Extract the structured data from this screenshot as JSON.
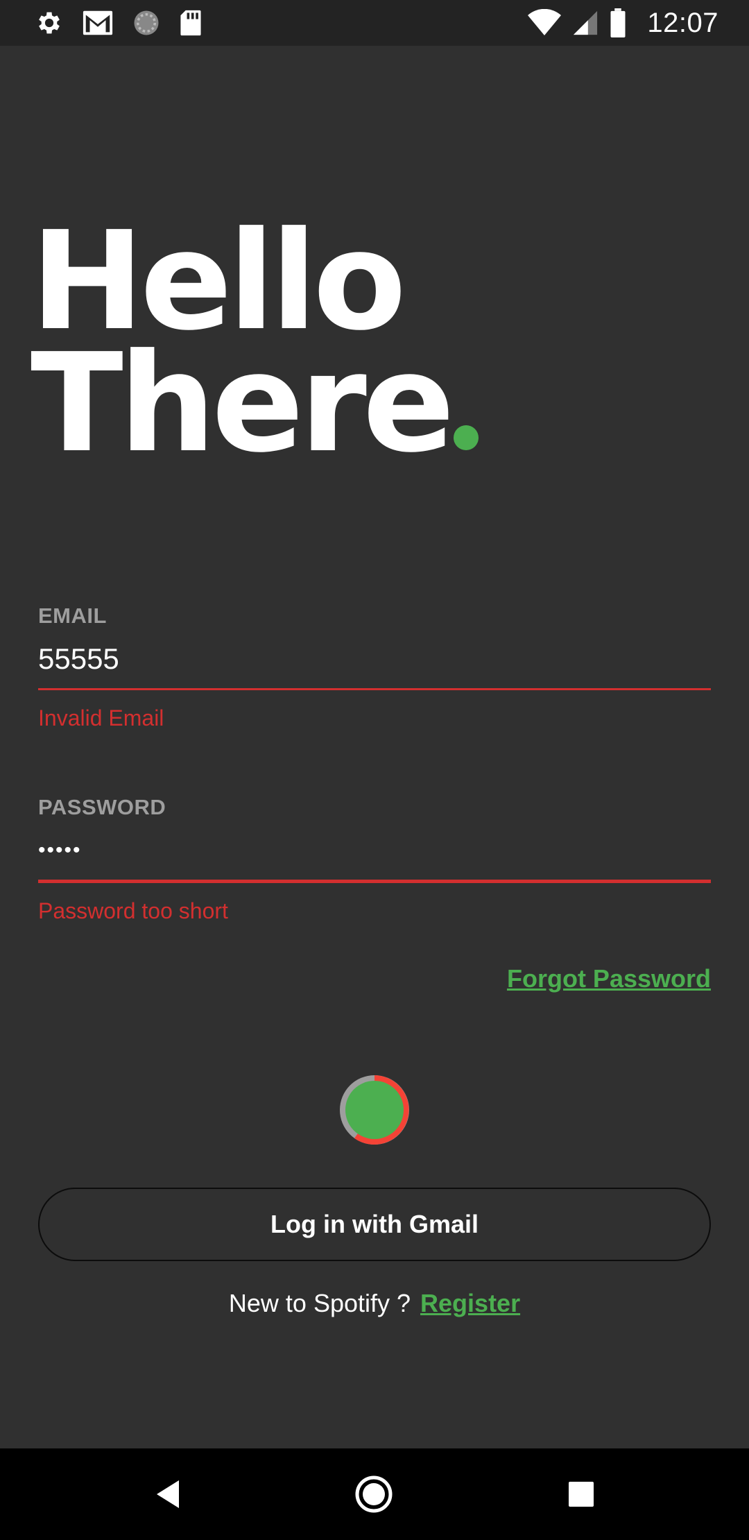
{
  "status_bar": {
    "time": "12:07",
    "left_icons": [
      "gear-icon",
      "gmail-icon",
      "sync-icon",
      "sd-card-icon"
    ],
    "right_icons": [
      "wifi-icon",
      "cell-signal-icon",
      "battery-icon"
    ]
  },
  "heading": {
    "line1": "Hello",
    "line2": "There",
    "accent_color": "#4caf50"
  },
  "email_field": {
    "label": "EMAIL",
    "value": "55555",
    "error": "Invalid Email"
  },
  "password_field": {
    "label": "PASSWORD",
    "value": "•••••",
    "error": "Password too short"
  },
  "forgot_password": "Forgot Password",
  "gmail_button": "Log in with Gmail",
  "register": {
    "prompt": "New to Spotify ?",
    "link": "Register"
  },
  "nav_bar": {
    "buttons": [
      "back-icon",
      "home-icon",
      "recents-icon"
    ]
  },
  "colors": {
    "background": "#303030",
    "accent": "#4caf50",
    "error": "#d32f2f"
  }
}
